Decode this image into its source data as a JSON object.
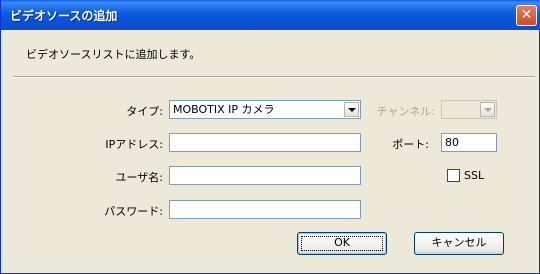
{
  "window": {
    "title": "ビデオソースの追加",
    "close_label": "✕"
  },
  "intro_text": "ビデオソースリストに追加します。",
  "form": {
    "type_label": "タイプ:",
    "type_value": "MOBOTIX IP カメラ",
    "channel_label": "チャンネル:",
    "channel_value": "",
    "ip_label": "IPアドレス:",
    "ip_value": "",
    "port_label": "ポート:",
    "port_value": "80",
    "user_label": "ユーザ名:",
    "user_value": "",
    "ssl_label": "SSL",
    "ssl_checked": false,
    "password_label": "パスワード:",
    "password_value": ""
  },
  "buttons": {
    "ok_label": "OK",
    "cancel_label": "キャンセル"
  }
}
